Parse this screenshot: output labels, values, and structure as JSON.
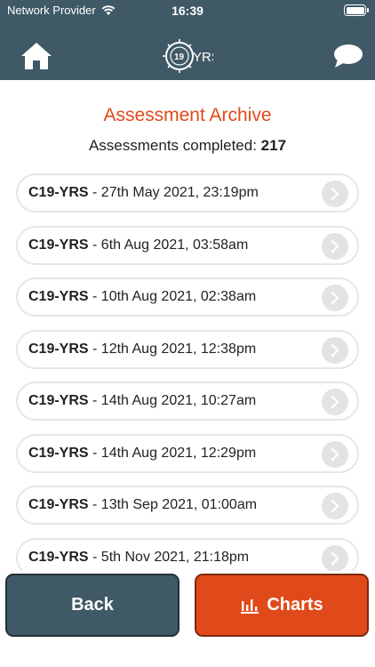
{
  "status_bar": {
    "carrier": "Network Provider",
    "time": "16:39"
  },
  "header": {
    "logo_text": "19·YRS",
    "icons": [
      "home-icon",
      "c19-yrs-logo",
      "chat-bubble-icon"
    ]
  },
  "page": {
    "title": "Assessment Archive",
    "count_label": "Assessments completed:",
    "count_value": "217"
  },
  "assessments": [
    {
      "code": "C19-YRS",
      "date": " - 27th May 2021, 23:19pm"
    },
    {
      "code": "C19-YRS",
      "date": " - 6th Aug 2021, 03:58am"
    },
    {
      "code": "C19-YRS",
      "date": " - 10th Aug 2021, 02:38am"
    },
    {
      "code": "C19-YRS",
      "date": " - 12th Aug 2021, 12:38pm"
    },
    {
      "code": "C19-YRS",
      "date": " - 14th Aug 2021, 10:27am"
    },
    {
      "code": "C19-YRS",
      "date": " - 14th Aug 2021, 12:29pm"
    },
    {
      "code": "C19-YRS",
      "date": " - 13th Sep 2021, 01:00am"
    },
    {
      "code": "C19-YRS",
      "date": " - 5th Nov 2021, 21:18pm"
    }
  ],
  "footer": {
    "back_label": "Back",
    "charts_label": "Charts"
  },
  "colors": {
    "header": "#3f5966",
    "accent": "#e04a1a"
  }
}
